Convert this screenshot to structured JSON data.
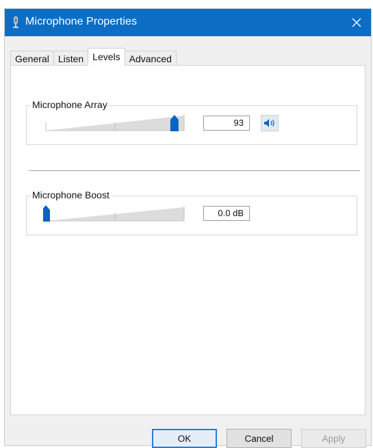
{
  "window": {
    "title": "Microphone Properties",
    "icon": "microphone-icon",
    "close_icon": "close-icon"
  },
  "tabs": [
    {
      "label": "General",
      "active": false
    },
    {
      "label": "Listen",
      "active": false
    },
    {
      "label": "Levels",
      "active": true
    },
    {
      "label": "Advanced",
      "active": false
    }
  ],
  "levels": {
    "microphone_array": {
      "label": "Microphone Array",
      "value": "93",
      "level": 0.93,
      "speaker_icon": "speaker-icon"
    },
    "microphone_boost": {
      "label": "Microphone Boost",
      "value": "0.0 dB",
      "level": 0.0
    }
  },
  "buttons": {
    "ok": "OK",
    "cancel": "Cancel",
    "apply": "Apply"
  },
  "colors": {
    "titlebar": "#0b6ec4",
    "slider_thumb": "#0a64c2",
    "slider_ramp": "#d9d9d9"
  }
}
